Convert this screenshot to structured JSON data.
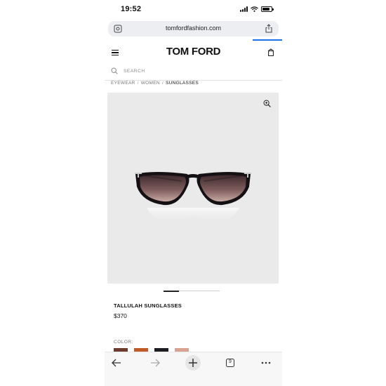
{
  "status_bar": {
    "time": "19:52"
  },
  "browser": {
    "url": "tomfordfashion.com",
    "tab_count": "9"
  },
  "site": {
    "logo": "TOM FORD",
    "search_placeholder": "SEARCH",
    "breadcrumb": [
      "EYEWEAR",
      "WOMEN",
      "SUNGLASSES"
    ],
    "breadcrumb_separator": "/"
  },
  "product": {
    "name": "TALLULAH SUNGLASSES",
    "price": "$370",
    "carousel": {
      "active_index": 0,
      "total": 4
    },
    "color_label": "COLOR:",
    "colors": [
      "#6b3a2c",
      "#c25a28",
      "#1c1c22",
      "#d9a394"
    ]
  },
  "colors": {
    "accent": "#1a73e8",
    "image_background": "#eaeaea"
  },
  "icons": {
    "url_left": "page-settings-icon",
    "url_right": "share-icon",
    "menu": "hamburger-menu-icon",
    "bag": "shopping-bag-icon",
    "search": "search-icon",
    "zoom": "zoom-in-icon",
    "back": "back-arrow-icon",
    "forward": "forward-arrow-icon",
    "new_tab": "plus-icon",
    "tabs": "tabs-icon",
    "more": "more-icon"
  }
}
